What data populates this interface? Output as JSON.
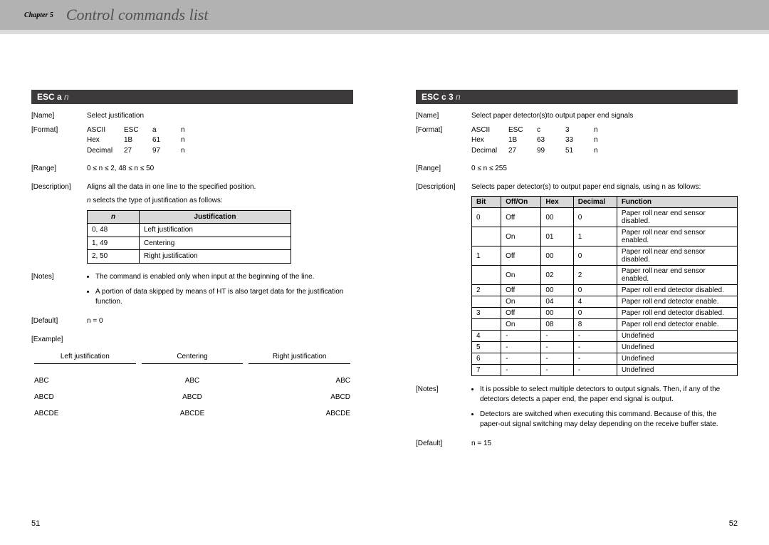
{
  "header": {
    "chapter": "Chapter 5",
    "title": "Control commands list"
  },
  "page_left": {
    "number": "51",
    "cmd_title_a": "ESC a ",
    "cmd_title_b": "n",
    "name_lbl": "[Name]",
    "name_val": "Select justification",
    "format_lbl": "[Format]",
    "fmt": {
      "r1": [
        "ASCII",
        "ESC",
        "a",
        "n",
        ""
      ],
      "r2": [
        "Hex",
        "1B",
        "61",
        "n",
        ""
      ],
      "r3": [
        "Decimal",
        "27",
        "97",
        "n",
        ""
      ]
    },
    "range_lbl": "[Range]",
    "range_val": "0 ≤ n ≤ 2, 48 ≤ n ≤ 50",
    "desc_lbl": "[Description]",
    "desc_val": "Aligns all the data in one line to the specified position.",
    "desc_sub_i": "n",
    "desc_sub": " selects the type of justification as follows:",
    "jt_head_n": "n",
    "jt_head_j": "Justification",
    "jt_rows": [
      [
        "0, 48",
        "Left justification"
      ],
      [
        "1, 49",
        "Centering"
      ],
      [
        "2, 50",
        "Right justification"
      ]
    ],
    "notes_lbl": "[Notes]",
    "notes": [
      "The command is enabled only when input at the beginning of the line.",
      "A portion of data skipped by means of HT is also target data for the justification function."
    ],
    "default_lbl": "[Default]",
    "default_val": "n = 0",
    "example_lbl": "[Example]",
    "ex_headers": [
      "Left justification",
      "Centering",
      "Right justification"
    ],
    "ex_rows": [
      [
        "ABC",
        "ABC",
        "ABC"
      ],
      [
        "ABCD",
        "ABCD",
        "ABCD"
      ],
      [
        "ABCDE",
        "ABCDE",
        "ABCDE"
      ]
    ]
  },
  "page_right": {
    "number": "52",
    "cmd_title_a": "ESC c 3 ",
    "cmd_title_b": "n",
    "name_lbl": "[Name]",
    "name_val": "Select paper detector(s)to output paper end signals",
    "format_lbl": "[Format]",
    "fmt": {
      "r1": [
        "ASCII",
        "ESC",
        "c",
        "3",
        "n"
      ],
      "r2": [
        "Hex",
        "1B",
        "63",
        "33",
        "n"
      ],
      "r3": [
        "Decimal",
        "27",
        "99",
        "51",
        "n"
      ]
    },
    "range_lbl": "[Range]",
    "range_val": "0 ≤ n ≤ 255",
    "desc_lbl": "[Description]",
    "desc_val": "Selects paper detector(s) to output paper end signals, using n as follows:",
    "bt_head": [
      "Bit",
      "Off/On",
      "Hex",
      "Decimal",
      "Function"
    ],
    "bt_rows": [
      [
        "0",
        "Off",
        "00",
        "0",
        "Paper roll near end sensor disabled."
      ],
      [
        "",
        "On",
        "01",
        "1",
        "Paper roll near end sensor enabled."
      ],
      [
        "1",
        "Off",
        "00",
        "0",
        "Paper roll near end sensor disabled."
      ],
      [
        "",
        "On",
        "02",
        "2",
        "Paper roll near end sensor enabled."
      ],
      [
        "2",
        "Off",
        "00",
        "0",
        "Paper roll end detector disabled."
      ],
      [
        "",
        "On",
        "04",
        "4",
        "Paper roll end detector enable."
      ],
      [
        "3",
        "Off",
        "00",
        "0",
        "Paper roll end detector disabled."
      ],
      [
        "",
        "On",
        "08",
        "8",
        "Paper roll end detector enable."
      ],
      [
        "4",
        "-",
        "-",
        "-",
        "Undefined"
      ],
      [
        "5",
        "-",
        "-",
        "-",
        "Undefined"
      ],
      [
        "6",
        "-",
        "-",
        "-",
        "Undefined"
      ],
      [
        "7",
        "-",
        "-",
        "-",
        "Undefined"
      ]
    ],
    "notes_lbl": "[Notes]",
    "notes": [
      "It is possible to select multiple detectors to output signals. Then, if any of the detectors detects a paper end, the paper end signal is output.",
      "Detectors are switched when executing this command. Because of this, the paper-out signal switching may delay depending on the receive buffer state."
    ],
    "default_lbl": "[Default]",
    "default_val": "n = 15"
  }
}
